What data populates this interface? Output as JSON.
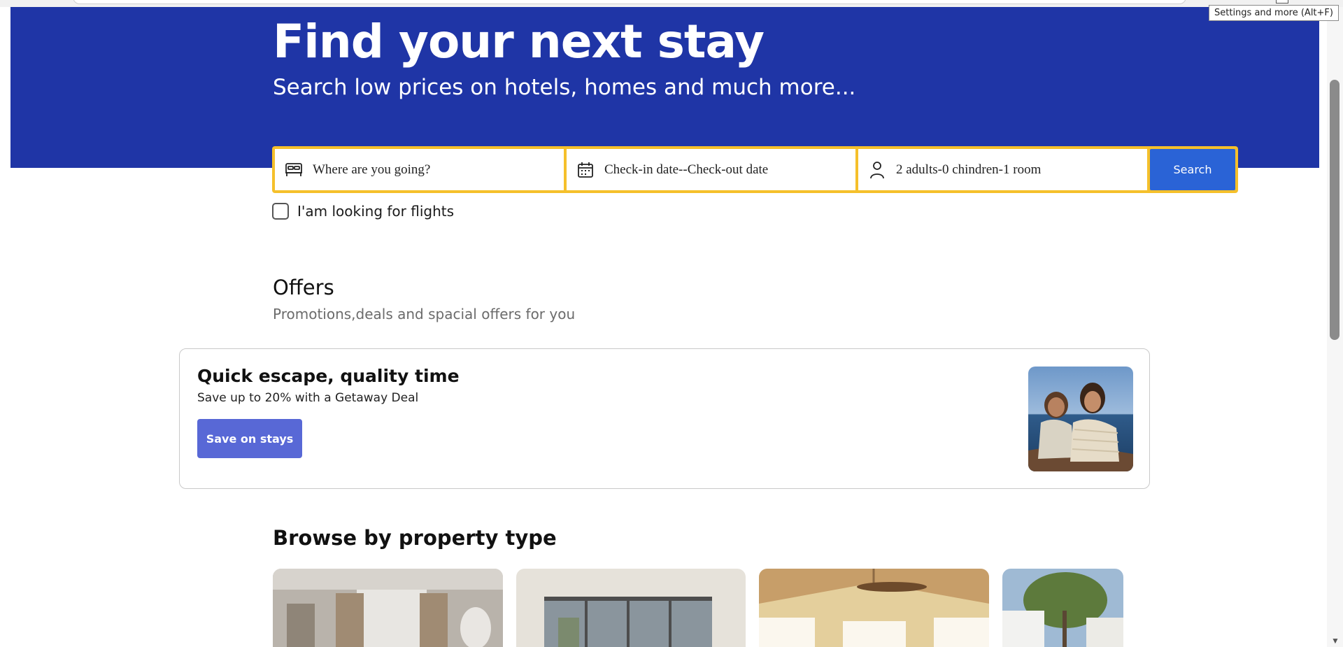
{
  "browser": {
    "tooltip": "Settings and more (Alt+F)"
  },
  "hero": {
    "title": "Find your next stay",
    "subtitle": "Search low prices on hotels, homes and much more..."
  },
  "search": {
    "destination_placeholder": "Where are you going?",
    "dates_placeholder": "Check-in date--Check-out date",
    "guests_summary": "2 adults-0 chindren-1 room",
    "search_label": "Search",
    "flights_checkbox_label": "I'am looking for flights",
    "flights_checked": false
  },
  "offers": {
    "heading": "Offers",
    "subheading": "Promotions,deals and spacial offers for you",
    "card": {
      "title": "Quick escape, quality time",
      "subtitle": "Save up to 20% with a Getaway Deal",
      "button_label": "Save on stays"
    }
  },
  "browse": {
    "heading": "Browse by property type"
  },
  "colors": {
    "brand_blue": "#1f35a6",
    "search_border": "#f5c02b",
    "search_button": "#2a63d6",
    "offer_button": "#5868d6"
  },
  "icons": {
    "destination": "bed-icon",
    "dates": "calendar-icon",
    "guests": "person-icon"
  }
}
